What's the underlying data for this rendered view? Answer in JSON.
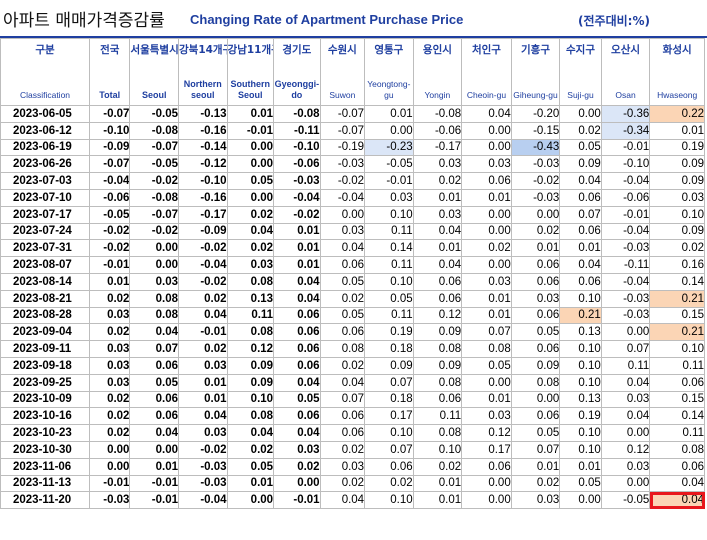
{
  "title": {
    "korean": "아파트 매매가격증감률",
    "english": "Changing Rate of Apartment Purchase Price",
    "unit": "(전주대비:%)"
  },
  "columns": [
    {
      "ko": "구분",
      "en": "Classification"
    },
    {
      "ko": "전국",
      "en": "Total"
    },
    {
      "ko": "서울특별시",
      "en": "Seoul"
    },
    {
      "ko": "강북14개구",
      "en": "Northern seoul"
    },
    {
      "ko": "강남11개구",
      "en": "Southern Seoul"
    },
    {
      "ko": "경기도",
      "en": "Gyeonggi-do"
    },
    {
      "ko": "수원시",
      "en": "Suwon"
    },
    {
      "ko": "영통구",
      "en": "Yeongtong-gu"
    },
    {
      "ko": "용인시",
      "en": "Yongin"
    },
    {
      "ko": "처인구",
      "en": "Cheoin-gu"
    },
    {
      "ko": "기흥구",
      "en": "Giheung-gu"
    },
    {
      "ko": "수지구",
      "en": "Suji-gu"
    },
    {
      "ko": "오산시",
      "en": "Osan"
    },
    {
      "ko": "화성시",
      "en": "Hwaseong"
    }
  ],
  "rows": [
    [
      "2023-06-05",
      "-0.07",
      "-0.05",
      "-0.13",
      "0.01",
      "-0.08",
      "-0.07",
      "0.01",
      "-0.08",
      "0.04",
      "-0.20",
      "0.00",
      "-0.36",
      "0.22"
    ],
    [
      "2023-06-12",
      "-0.10",
      "-0.08",
      "-0.16",
      "-0.01",
      "-0.11",
      "-0.07",
      "0.00",
      "-0.06",
      "0.00",
      "-0.15",
      "0.02",
      "-0.34",
      "0.01"
    ],
    [
      "2023-06-19",
      "-0.09",
      "-0.07",
      "-0.14",
      "0.00",
      "-0.10",
      "-0.19",
      "-0.23",
      "-0.17",
      "0.00",
      "-0.43",
      "0.05",
      "-0.01",
      "0.19"
    ],
    [
      "2023-06-26",
      "-0.07",
      "-0.05",
      "-0.12",
      "0.00",
      "-0.06",
      "-0.03",
      "-0.05",
      "0.03",
      "0.03",
      "-0.03",
      "0.09",
      "-0.10",
      "0.09"
    ],
    [
      "2023-07-03",
      "-0.04",
      "-0.02",
      "-0.10",
      "0.05",
      "-0.03",
      "-0.02",
      "-0.01",
      "0.02",
      "0.06",
      "-0.02",
      "0.04",
      "-0.04",
      "0.09"
    ],
    [
      "2023-07-10",
      "-0.06",
      "-0.08",
      "-0.16",
      "0.00",
      "-0.04",
      "-0.04",
      "0.03",
      "0.01",
      "0.01",
      "-0.03",
      "0.06",
      "-0.06",
      "0.03"
    ],
    [
      "2023-07-17",
      "-0.05",
      "-0.07",
      "-0.17",
      "0.02",
      "-0.02",
      "0.00",
      "0.10",
      "0.03",
      "0.00",
      "0.00",
      "0.07",
      "-0.01",
      "0.10"
    ],
    [
      "2023-07-24",
      "-0.02",
      "-0.02",
      "-0.09",
      "0.04",
      "0.01",
      "0.03",
      "0.11",
      "0.04",
      "0.00",
      "0.02",
      "0.06",
      "-0.04",
      "0.09"
    ],
    [
      "2023-07-31",
      "-0.02",
      "0.00",
      "-0.02",
      "0.02",
      "0.01",
      "0.04",
      "0.14",
      "0.01",
      "0.02",
      "0.01",
      "0.01",
      "-0.03",
      "0.02"
    ],
    [
      "2023-08-07",
      "-0.01",
      "0.00",
      "-0.04",
      "0.03",
      "0.01",
      "0.06",
      "0.11",
      "0.04",
      "0.00",
      "0.06",
      "0.04",
      "-0.11",
      "0.16"
    ],
    [
      "2023-08-14",
      "0.01",
      "0.03",
      "-0.02",
      "0.08",
      "0.04",
      "0.05",
      "0.10",
      "0.06",
      "0.03",
      "0.06",
      "0.06",
      "-0.04",
      "0.14"
    ],
    [
      "2023-08-21",
      "0.02",
      "0.08",
      "0.02",
      "0.13",
      "0.04",
      "0.02",
      "0.05",
      "0.06",
      "0.01",
      "0.03",
      "0.10",
      "-0.03",
      "0.21"
    ],
    [
      "2023-08-28",
      "0.03",
      "0.08",
      "0.04",
      "0.11",
      "0.06",
      "0.05",
      "0.11",
      "0.12",
      "0.01",
      "0.06",
      "0.21",
      "-0.03",
      "0.15"
    ],
    [
      "2023-09-04",
      "0.02",
      "0.04",
      "-0.01",
      "0.08",
      "0.06",
      "0.06",
      "0.19",
      "0.09",
      "0.07",
      "0.05",
      "0.13",
      "0.00",
      "0.21"
    ],
    [
      "2023-09-11",
      "0.03",
      "0.07",
      "0.02",
      "0.12",
      "0.06",
      "0.08",
      "0.18",
      "0.08",
      "0.08",
      "0.06",
      "0.10",
      "0.07",
      "0.10"
    ],
    [
      "2023-09-18",
      "0.03",
      "0.06",
      "0.03",
      "0.09",
      "0.06",
      "0.02",
      "0.09",
      "0.09",
      "0.05",
      "0.09",
      "0.10",
      "0.11",
      "0.11"
    ],
    [
      "2023-09-25",
      "0.03",
      "0.05",
      "0.01",
      "0.09",
      "0.04",
      "0.04",
      "0.07",
      "0.08",
      "0.00",
      "0.08",
      "0.10",
      "0.04",
      "0.06"
    ],
    [
      "2023-10-09",
      "0.02",
      "0.06",
      "0.01",
      "0.10",
      "0.05",
      "0.07",
      "0.18",
      "0.06",
      "0.01",
      "0.00",
      "0.13",
      "0.03",
      "0.15"
    ],
    [
      "2023-10-16",
      "0.02",
      "0.06",
      "0.04",
      "0.08",
      "0.06",
      "0.06",
      "0.17",
      "0.11",
      "0.03",
      "0.06",
      "0.19",
      "0.04",
      "0.14"
    ],
    [
      "2023-10-23",
      "0.02",
      "0.04",
      "0.03",
      "0.04",
      "0.04",
      "0.06",
      "0.10",
      "0.08",
      "0.12",
      "0.05",
      "0.10",
      "0.00",
      "0.11"
    ],
    [
      "2023-10-30",
      "0.00",
      "0.00",
      "-0.02",
      "0.02",
      "0.03",
      "0.02",
      "0.07",
      "0.10",
      "0.17",
      "0.07",
      "0.10",
      "0.12",
      "0.08"
    ],
    [
      "2023-11-06",
      "0.00",
      "0.01",
      "-0.03",
      "0.05",
      "0.02",
      "0.03",
      "0.06",
      "0.02",
      "0.06",
      "0.01",
      "0.01",
      "0.03",
      "0.06"
    ],
    [
      "2023-11-13",
      "-0.01",
      "-0.01",
      "-0.03",
      "0.01",
      "0.00",
      "0.02",
      "0.02",
      "0.01",
      "0.00",
      "0.02",
      "0.05",
      "0.00",
      "0.04"
    ],
    [
      "2023-11-20",
      "-0.03",
      "-0.01",
      "-0.04",
      "0.00",
      "-0.01",
      "0.04",
      "0.10",
      "0.01",
      "0.00",
      "0.03",
      "0.00",
      "-0.05",
      "0.04"
    ]
  ],
  "highlight_colors": {
    "light_blue": "#dbe6f7",
    "blue": "#b8cff0",
    "orange": "#fbd5b5",
    "red_box": "#e8171c"
  }
}
